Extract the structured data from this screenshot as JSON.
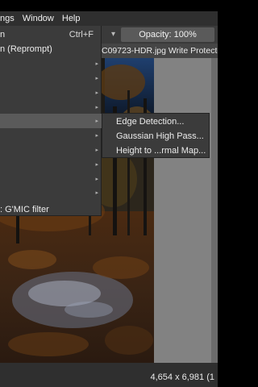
{
  "menubar": {
    "items": [
      "ngs",
      "Window",
      "Help"
    ]
  },
  "toolbar": {
    "opacity": "Opacity: 100%"
  },
  "tab": {
    "title": "C09723-HDR.jpg Write Protecte"
  },
  "dropdown": {
    "items": [
      {
        "label": "n",
        "shortcut": "Ctrl+F",
        "has_submenu": false
      },
      {
        "label": "n (Reprompt)",
        "shortcut": "",
        "has_submenu": false
      },
      {
        "label": "",
        "shortcut": "",
        "has_submenu": true
      },
      {
        "label": "",
        "shortcut": "",
        "has_submenu": true
      },
      {
        "label": "",
        "shortcut": "",
        "has_submenu": true
      },
      {
        "label": "",
        "shortcut": "",
        "has_submenu": true
      },
      {
        "label": "",
        "shortcut": "",
        "has_submenu": true,
        "highlighted": true
      },
      {
        "label": "",
        "shortcut": "",
        "has_submenu": true
      },
      {
        "label": "",
        "shortcut": "",
        "has_submenu": true
      },
      {
        "label": "",
        "shortcut": "",
        "has_submenu": true
      },
      {
        "label": "",
        "shortcut": "",
        "has_submenu": true
      },
      {
        "label": "",
        "shortcut": "",
        "has_submenu": true
      },
      {
        "label": ": G'MIC filter",
        "shortcut": "",
        "has_submenu": false
      }
    ]
  },
  "submenu": {
    "items": [
      "Edge Detection...",
      "Gaussian High Pass...",
      "Height to ...rmal Map..."
    ]
  },
  "status": {
    "dimensions": "4,654 x 6,981 (1"
  },
  "colors": {
    "menubar_bg": "#2f2f2f",
    "menu_bg": "#3b3b3b",
    "highlight": "#5a5a5a",
    "canvas_bg": "#828282"
  }
}
